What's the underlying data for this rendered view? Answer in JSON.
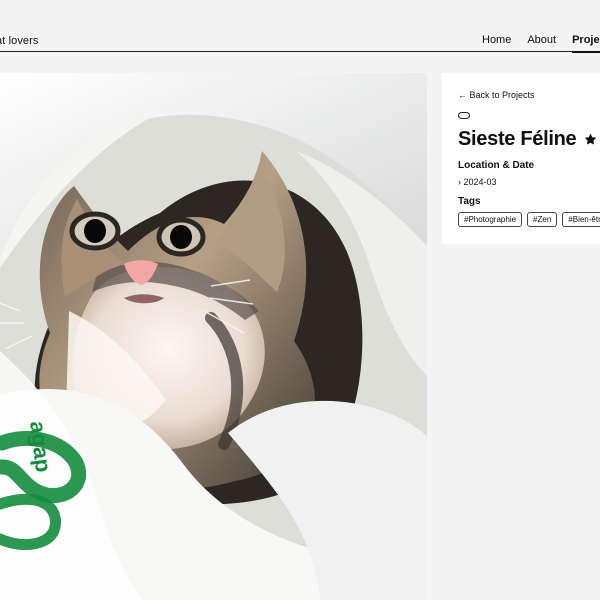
{
  "header": {
    "site_title": "Cat lovers",
    "nav": [
      {
        "label": "Home"
      },
      {
        "label": "About"
      },
      {
        "label": "Projects"
      }
    ]
  },
  "photo": {
    "plastic_bag_text": "agap"
  },
  "detail": {
    "back_label": "← Back to Projects",
    "title": "Sieste Féline",
    "location_date_label": "Location & Date",
    "date": "› 2024-03",
    "tags_label": "Tags",
    "tags": [
      {
        "label": "#Photographie"
      },
      {
        "label": "#Zen"
      },
      {
        "label": "#Bien-être"
      }
    ]
  },
  "icons": {
    "back": "left-arrow-icon",
    "favorite": "star-icon"
  },
  "colors": {
    "background": "#f4f4f4",
    "card": "#ffffff",
    "text": "#111111",
    "bag_green": "#148c3d"
  }
}
